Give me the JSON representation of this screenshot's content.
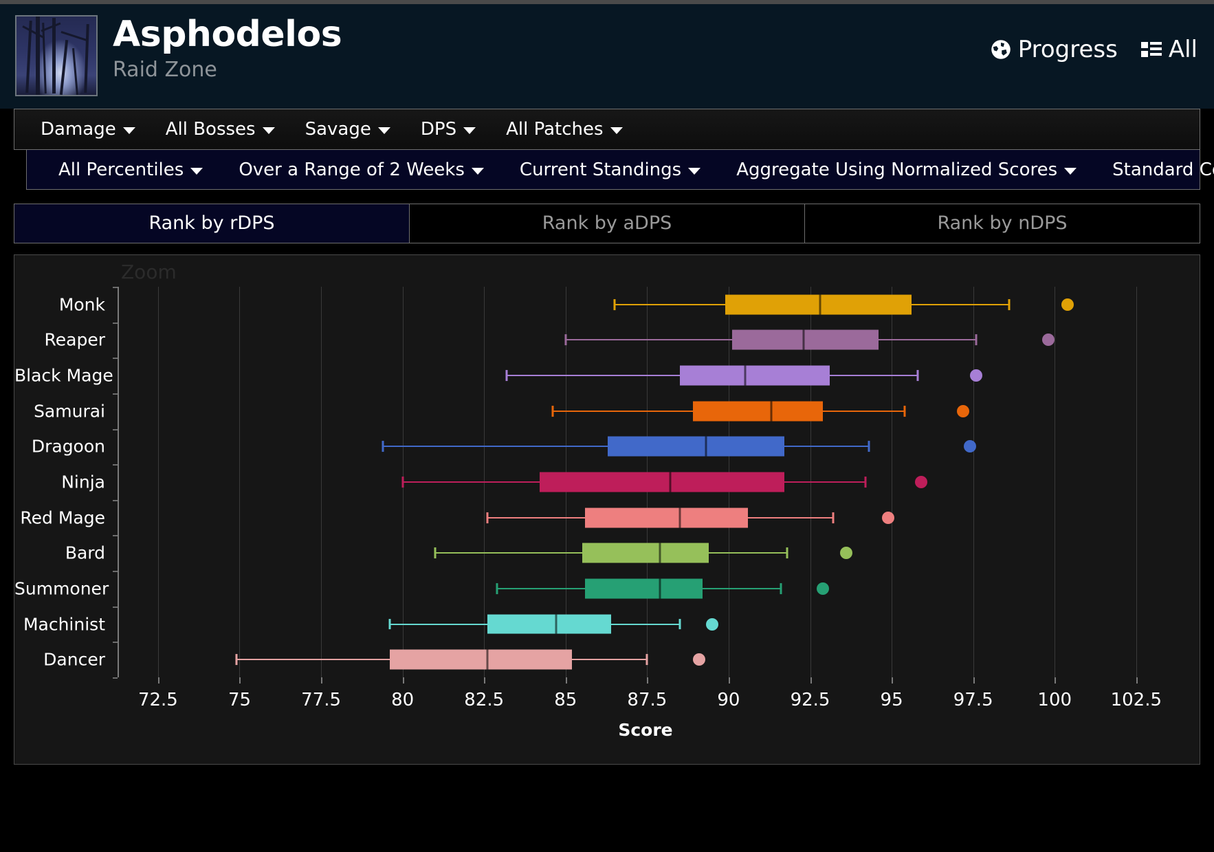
{
  "header": {
    "title": "Asphodelos",
    "subtitle": "Raid Zone",
    "thumb_name": "zone-thumbnail",
    "progress_label": "Progress",
    "progress_icon": "globe-icon",
    "all_label": "All",
    "all_icon": "list-icon"
  },
  "filters_primary": [
    {
      "label": "Damage"
    },
    {
      "label": "All Bosses"
    },
    {
      "label": "Savage"
    },
    {
      "label": "DPS"
    },
    {
      "label": "All Patches"
    }
  ],
  "filters_secondary": [
    {
      "label": "All Percentiles"
    },
    {
      "label": "Over a Range of 2 Weeks"
    },
    {
      "label": "Current Standings"
    },
    {
      "label": "Aggregate Using Normalized Scores"
    },
    {
      "label": "Standard Comps"
    }
  ],
  "tabs": [
    {
      "label": "Rank by rDPS",
      "active": true
    },
    {
      "label": "Rank by aDPS",
      "active": false
    },
    {
      "label": "Rank by nDPS",
      "active": false
    }
  ],
  "chart_panel": {
    "zoom_label": "Zoom"
  },
  "chart_data": {
    "type": "box",
    "title": "",
    "xlabel": "Score",
    "ylabel": "",
    "xlim": [
      71.3,
      103.6
    ],
    "xticks": [
      72.5,
      75,
      77.5,
      80,
      82.5,
      85,
      87.5,
      90,
      92.5,
      95,
      97.5,
      100,
      102.5
    ],
    "xticklabels": [
      "72.5",
      "75",
      "77.5",
      "80",
      "82.5",
      "85",
      "87.5",
      "90",
      "92.5",
      "95",
      "97.5",
      "100",
      "102.5"
    ],
    "grid": true,
    "legend": "none",
    "categories": [
      "Monk",
      "Reaper",
      "Black Mage",
      "Samurai",
      "Dragoon",
      "Ninja",
      "Red Mage",
      "Bard",
      "Summoner",
      "Machinist",
      "Dancer"
    ],
    "boxes": [
      {
        "name": "Monk",
        "color": "#E0A106",
        "whisker_low": 86.5,
        "q1": 89.9,
        "median": 92.8,
        "q3": 95.6,
        "whisker_high": 98.6,
        "outliers": [
          100.4
        ]
      },
      {
        "name": "Reaper",
        "color": "#9B6A9B",
        "whisker_low": 85.0,
        "q1": 90.1,
        "median": 92.3,
        "q3": 94.6,
        "whisker_high": 97.6,
        "outliers": [
          99.8
        ]
      },
      {
        "name": "Black Mage",
        "color": "#A77FD6",
        "whisker_low": 83.2,
        "q1": 88.5,
        "median": 90.5,
        "q3": 93.1,
        "whisker_high": 95.8,
        "outliers": [
          97.6
        ]
      },
      {
        "name": "Samurai",
        "color": "#E8660A",
        "whisker_low": 84.6,
        "q1": 88.9,
        "median": 91.3,
        "q3": 92.9,
        "whisker_high": 95.4,
        "outliers": [
          97.2
        ]
      },
      {
        "name": "Dragoon",
        "color": "#4169C9",
        "whisker_low": 79.4,
        "q1": 86.3,
        "median": 89.3,
        "q3": 91.7,
        "whisker_high": 94.3,
        "outliers": [
          97.4
        ]
      },
      {
        "name": "Ninja",
        "color": "#BE1E5A",
        "whisker_low": 80.0,
        "q1": 84.2,
        "median": 88.2,
        "q3": 91.7,
        "whisker_high": 94.2,
        "outliers": [
          95.9
        ]
      },
      {
        "name": "Red Mage",
        "color": "#EE7F7F",
        "whisker_low": 82.6,
        "q1": 85.6,
        "median": 88.5,
        "q3": 90.6,
        "whisker_high": 93.2,
        "outliers": [
          94.9
        ]
      },
      {
        "name": "Bard",
        "color": "#96C05A",
        "whisker_low": 81.0,
        "q1": 85.5,
        "median": 87.9,
        "q3": 89.4,
        "whisker_high": 91.8,
        "outliers": [
          93.6
        ]
      },
      {
        "name": "Summoner",
        "color": "#26A074",
        "whisker_low": 82.9,
        "q1": 85.6,
        "median": 87.9,
        "q3": 89.2,
        "whisker_high": 91.6,
        "outliers": [
          92.9
        ]
      },
      {
        "name": "Machinist",
        "color": "#65D9D1",
        "whisker_low": 79.6,
        "q1": 82.6,
        "median": 84.7,
        "q3": 86.4,
        "whisker_high": 88.5,
        "outliers": [
          89.5
        ]
      },
      {
        "name": "Dancer",
        "color": "#E5A3A3",
        "whisker_low": 74.9,
        "q1": 79.6,
        "median": 82.6,
        "q3": 85.2,
        "whisker_high": 87.5,
        "outliers": [
          89.1
        ]
      }
    ]
  }
}
